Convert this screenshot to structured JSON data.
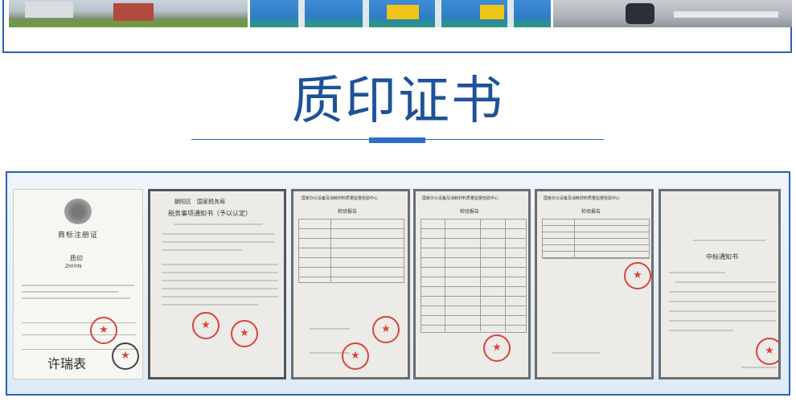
{
  "header": {
    "title": "质印证书"
  },
  "certificates": [
    {
      "heading": "商标注册证",
      "mark_name": "质印",
      "mark_latin": "ZHIYIN",
      "signature": "许瑞表"
    },
    {
      "authority": "朝阳区　国家税务局",
      "heading": "税务事项通知书（予以认定）"
    },
    {
      "heading": "国家办公设备及消耗材料质量监督检验中心",
      "subtitle": "检验报告"
    },
    {
      "heading": "国家办公设备及消耗材料质量监督检验中心",
      "subtitle": "检验报告"
    },
    {
      "heading": "国家办公设备及消耗材料质量监督检验中心",
      "subtitle": "检验报告"
    },
    {
      "heading": "中标通知书"
    }
  ],
  "colors": {
    "accent": "#1d5299",
    "border": "#2b62b2",
    "seal": "#d7453c"
  }
}
